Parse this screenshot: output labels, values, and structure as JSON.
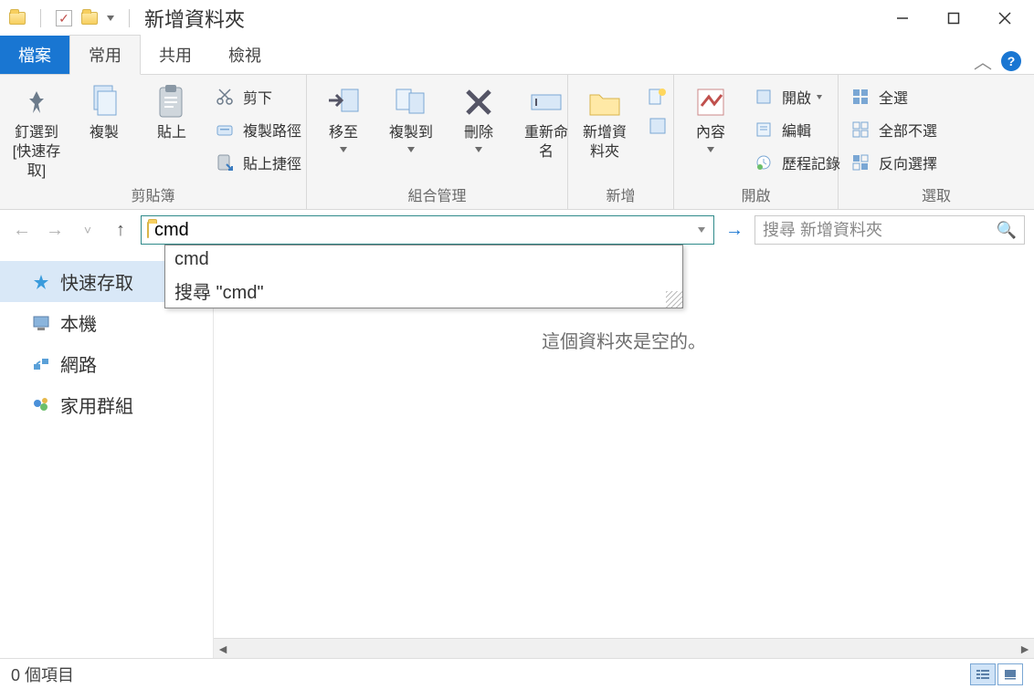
{
  "window": {
    "title": "新增資料夾"
  },
  "tabs": {
    "file": "檔案",
    "home": "常用",
    "share": "共用",
    "view": "檢視"
  },
  "ribbon": {
    "clipboard": {
      "group": "剪貼簿",
      "pin": "釘選到 [快速存取]",
      "copy": "複製",
      "paste": "貼上",
      "cut": "剪下",
      "copypath": "複製路徑",
      "pasteshortcut": "貼上捷徑"
    },
    "organize": {
      "group": "組合管理",
      "moveto": "移至",
      "copyto": "複製到",
      "delete": "刪除",
      "rename": "重新命名"
    },
    "new": {
      "group": "新增",
      "newfolder": "新增資料夾"
    },
    "open": {
      "group": "開啟",
      "properties": "內容",
      "open": "開啟",
      "edit": "編輯",
      "history": "歷程記錄"
    },
    "select": {
      "group": "選取",
      "all": "全選",
      "none": "全部不選",
      "invert": "反向選擇"
    }
  },
  "address": {
    "value": "cmd",
    "suggest1": "cmd",
    "suggest2": "搜尋 \"cmd\""
  },
  "search": {
    "placeholder": "搜尋 新增資料夾"
  },
  "nav": {
    "quick": "快速存取",
    "pc": "本機",
    "network": "網路",
    "homegroup": "家用群組"
  },
  "content": {
    "empty": "這個資料夾是空的。"
  },
  "status": {
    "items": "0 個項目"
  }
}
